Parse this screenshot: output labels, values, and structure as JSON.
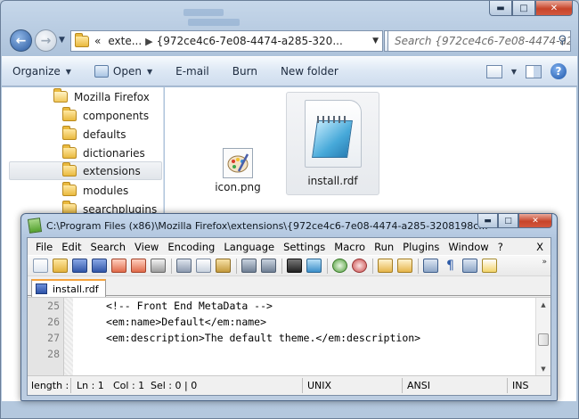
{
  "explorer": {
    "address": {
      "overflow": "«",
      "crumb_1": "exte...",
      "crumb_2": "{972ce4c6-7e08-4474-a285-320..."
    },
    "search_placeholder": "Search {972ce4c6-7e08-4474-a2...",
    "commands": {
      "organize": "Organize",
      "open": "Open",
      "email": "E-mail",
      "burn": "Burn",
      "new_folder": "New folder"
    },
    "tree": {
      "items": [
        {
          "label": "Mozilla Firefox"
        },
        {
          "label": "components"
        },
        {
          "label": "defaults"
        },
        {
          "label": "dictionaries"
        },
        {
          "label": "extensions"
        },
        {
          "label": "modules"
        },
        {
          "label": "searchplugins"
        }
      ]
    },
    "files": [
      {
        "name": "icon.png"
      },
      {
        "name": "install.rdf"
      }
    ]
  },
  "notepad": {
    "title": "C:\\Program Files (x86)\\Mozilla Firefox\\extensions\\{972ce4c6-7e08-4474-a285-3208198c...",
    "menu": [
      "File",
      "Edit",
      "Search",
      "View",
      "Encoding",
      "Language",
      "Settings",
      "Macro",
      "Run",
      "Plugins",
      "Window",
      "?"
    ],
    "menu_close": "X",
    "tab_label": "install.rdf",
    "lines": [
      {
        "num": "25",
        "code": "<!-- Front End MetaData -->"
      },
      {
        "num": "26",
        "code": "<em:name>Default</em:name>"
      },
      {
        "num": "27",
        "code": "<em:description>The default theme.</em:description>"
      },
      {
        "num": "28",
        "code": ""
      }
    ],
    "status": {
      "length": "length :",
      "ln": "Ln : 1",
      "col": "Col : 1",
      "sel": "Sel : 0 | 0",
      "eol": "UNIX",
      "encoding": "ANSI",
      "mode": "INS"
    }
  },
  "colors": {
    "explorer_frame": "#bfcedf",
    "selection": "#e1e5ea",
    "tab_accent": "#f5a33c"
  }
}
